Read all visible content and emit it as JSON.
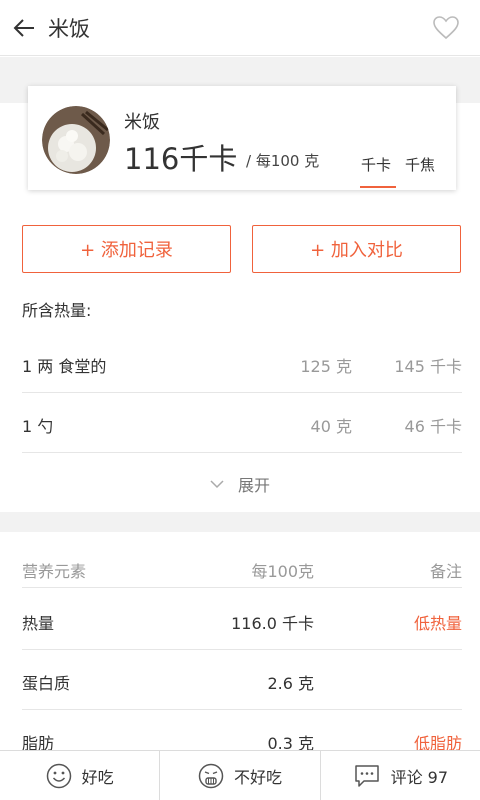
{
  "header": {
    "title": "米饭"
  },
  "food": {
    "name": "米饭",
    "calories": "116千卡",
    "per_unit": "/ 每100 克",
    "unit_tabs": [
      "千卡",
      "千焦"
    ]
  },
  "actions": {
    "add_record": "+ 添加记录",
    "add_compare": "+ 加入对比"
  },
  "servings": {
    "label": "所含热量:",
    "rows": [
      {
        "name": "1 两 食堂的",
        "grams": "125 克",
        "kcal": "145 千卡"
      },
      {
        "name": "1 勺",
        "grams": "40 克",
        "kcal": "46 千卡"
      }
    ],
    "expand_label": "展开"
  },
  "nutrition": {
    "headers": [
      "营养元素",
      "每100克",
      "备注"
    ],
    "rows": [
      {
        "name": "热量",
        "value": "116.0 千卡",
        "note": "低热量"
      },
      {
        "name": "蛋白质",
        "value": "2.6 克",
        "note": ""
      },
      {
        "name": "脂肪",
        "value": "0.3 克",
        "note": "低脂肪"
      }
    ]
  },
  "bottom": {
    "good": "好吃",
    "bad": "不好吃",
    "comments": "评论 97"
  },
  "colors": {
    "accent": "#f0623c",
    "divider": "#e6e6e6",
    "muted": "#999999"
  }
}
